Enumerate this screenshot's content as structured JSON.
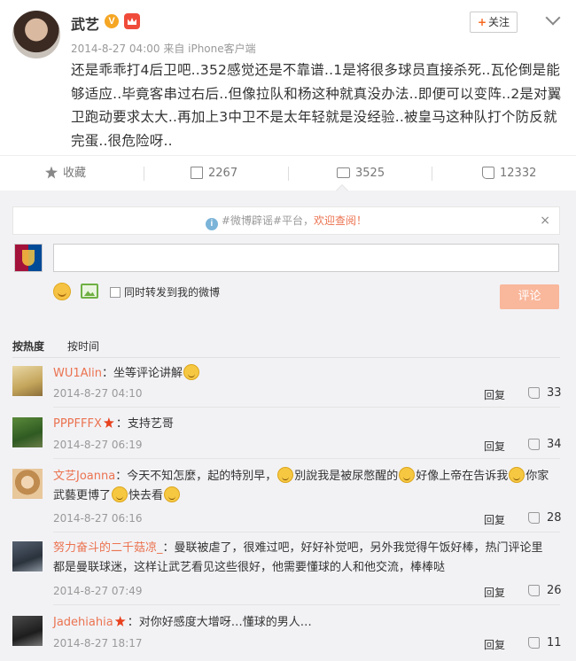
{
  "post": {
    "author": "武艺",
    "verified_mark": "V",
    "meta": "2014-8-27 04:00 来自 iPhone客户端",
    "follow_label": "关注",
    "follow_plus": "+",
    "text": "还是乖乖打4后卫吧..352感觉还是不靠谱..1是将很多球员直接杀死..瓦伦倒是能够适应..毕竟客串过右后..但像拉队和杨这种就真没办法..即便可以变阵..2是对翼卫跑动要求太大..再加上3中卫不是太年轻就是没经验..被皇马这种队打个防反就完蛋..很危险呀.."
  },
  "actions": {
    "favorite": "收藏",
    "reposts": "2267",
    "comments": "3525",
    "likes": "12332"
  },
  "notice": {
    "tag": "#微博辟谣#平台，",
    "link": "欢迎查阅！",
    "close": "×"
  },
  "composer": {
    "repost_label": "同时转发到我的微博",
    "submit_label": "评论"
  },
  "sort": {
    "hot": "按热度",
    "time": "按时间"
  },
  "comments": [
    {
      "name": "WU1Alin",
      "text": "：坐等评论讲解",
      "time": "2014-8-27 04:10",
      "reply": "回复",
      "likes": "33"
    },
    {
      "name": "PPPFFFX",
      "text": "：支持艺哥",
      "time": "2014-8-27 06:19",
      "reply": "回复",
      "likes": "34"
    },
    {
      "name": "文艺Joanna",
      "text_a": "：今天不知怎麼，起的特別早，",
      "text_b": "別說我是被尿憋醒的",
      "text_c": "好像上帝在告诉我",
      "text_d": "你家",
      "text_e": "武藝更博了",
      "text_f": "快去看",
      "time": "2014-8-27 06:16",
      "reply": "回复",
      "likes": "28"
    },
    {
      "name": "努力奋斗的二千菇凉_",
      "text": "：曼联被虐了，很难过吧，好好补觉吧，另外我觉得午饭好棒，热门评论里",
      "text2": "都是曼联球迷，这样让武艺看见这些很好，他需要懂球的人和他交流，棒棒哒",
      "time": "2014-8-27 07:49",
      "reply": "回复",
      "likes": "26"
    },
    {
      "name": "Jadehiahia",
      "text": "：对你好感度大增呀…懂球的男人…",
      "time": "2014-8-27 18:17",
      "reply": "回复",
      "likes": "11"
    }
  ]
}
